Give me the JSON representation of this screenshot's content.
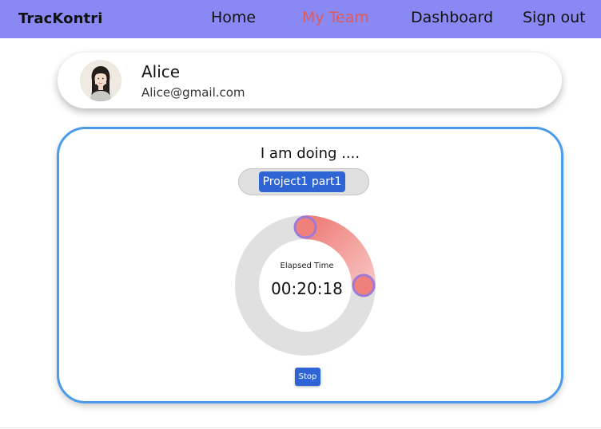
{
  "app": {
    "brand": "TracKontri"
  },
  "nav": {
    "home": "Home",
    "my_team": "My Team",
    "dashboard": "Dashboard",
    "sign_out": "Sign out",
    "active_color": "#e05a5a",
    "bar_color": "#8a88f3"
  },
  "profile": {
    "name": "Alice",
    "email": "Alice@gmail.com"
  },
  "tracker": {
    "heading": "I am doing ....",
    "selected_project": "Project1 part1",
    "elapsed_label": "Elapsed Time",
    "elapsed_value": "00:20:18",
    "progress_fraction": 0.25,
    "stop_label": "Stop",
    "progress_color": "#f0807c",
    "track_color": "#e0e0e0",
    "handle_border_color": "#9d7ad8"
  }
}
